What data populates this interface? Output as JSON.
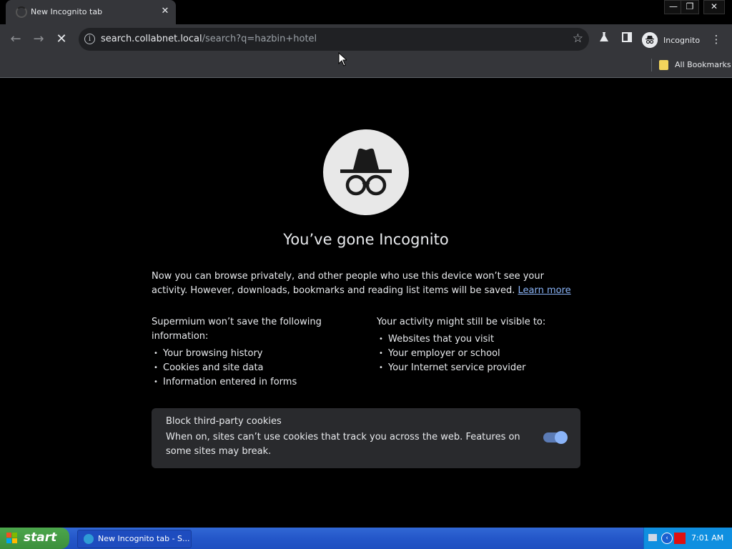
{
  "tab": {
    "title": "New Incognito tab"
  },
  "window_controls": {
    "minimize": "—",
    "restore": "❐",
    "close": "✕"
  },
  "toolbar": {
    "url_host": "search.collabnet.local",
    "url_path": "/search?q=hazbin+hotel",
    "profile_label": "Incognito"
  },
  "bookmarks": {
    "all_bookmarks": "All Bookmarks"
  },
  "page": {
    "headline": "You’ve gone Incognito",
    "intro": "Now you can browse privately, and other people who use this device won’t see your activity. However, downloads, bookmarks and reading list items will be saved.",
    "learn_more": "Learn more",
    "left_heading": "Supermium won’t save the following information:",
    "left_items": [
      "Your browsing history",
      "Cookies and site data",
      "Information entered in forms"
    ],
    "right_heading": "Your activity might still be visible to:",
    "right_items": [
      "Websites that you visit",
      "Your employer or school",
      "Your Internet service provider"
    ],
    "cookies_title": "Block third-party cookies",
    "cookies_desc": "When on, sites can’t use cookies that track you across the web. Features on some sites may break.",
    "cookies_toggle_on": true
  },
  "taskbar": {
    "start_label": "start",
    "task_item": "New Incognito tab - S...",
    "clock": "7:01 AM"
  },
  "colors": {
    "accent": "#8ab4f8",
    "toolbar_bg": "#35363a",
    "omnibox_bg": "#202124"
  }
}
